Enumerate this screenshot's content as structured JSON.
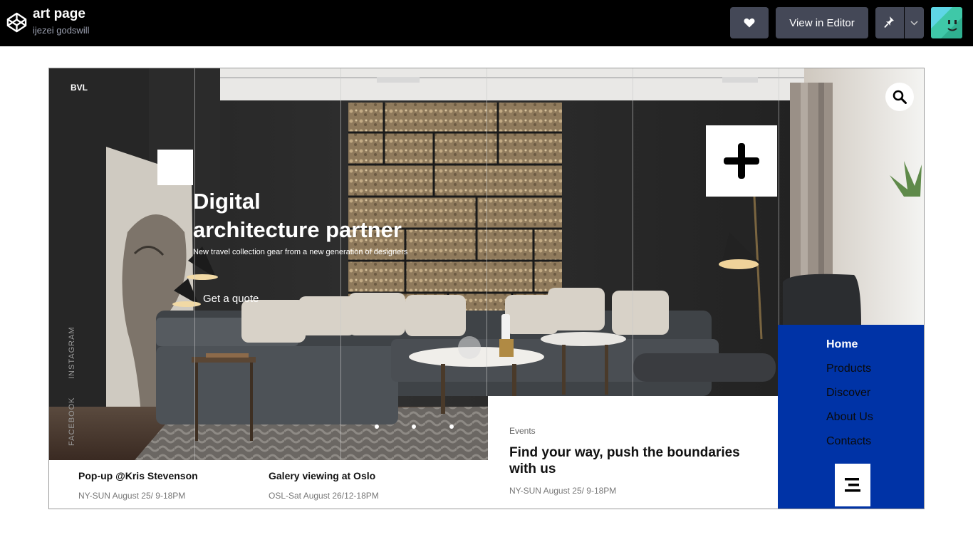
{
  "header": {
    "title": "art page",
    "author": "ijezei godswill",
    "editor_label": "View in Editor"
  },
  "site": {
    "brand": "BVL",
    "hero_title_line1": "Digital",
    "hero_title_line2": "architecture partner",
    "hero_subtitle": "New travel collection gear from a new generation of designers",
    "cta_label": "Get a quote",
    "social": [
      "INSTAGRAM",
      "FACEBOOK"
    ],
    "events": [
      {
        "title": "Pop-up @Kris Stevenson",
        "date": "NY-SUN August 25/ 9-18PM"
      },
      {
        "title": "Galery viewing at Oslo",
        "date": "OSL-Sat August 26/12-18PM"
      }
    ],
    "card": {
      "tag": "Events",
      "title": "Find your way, push the boundaries with us",
      "date": "NY-SUN August 25/ 9-18PM"
    },
    "nav": [
      "Home",
      "Products",
      "Discover",
      "About Us",
      "Contacts"
    ],
    "colors": {
      "nav_bg": "#0033a6",
      "topbar": "#000000",
      "button": "#444857"
    }
  }
}
